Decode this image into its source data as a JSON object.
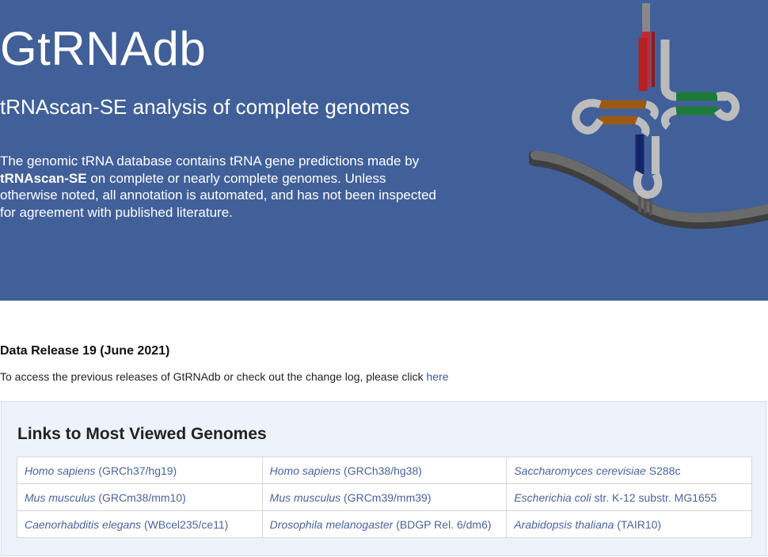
{
  "header": {
    "title": "GtRNAdb",
    "subtitle": "tRNAscan-SE analysis of complete genomes",
    "description_before": "The genomic tRNA database contains tRNA gene predictions made by ",
    "description_strong": "tRNAscan-SE",
    "description_after": " on complete or nearly complete genomes. Unless otherwise noted, all annotation is automated, and has not been inspected for agreement with published literature."
  },
  "release": {
    "title": "Data Release 19 (June 2021)",
    "text": "To access the previous releases of GtRNAdb or check out the change log, please click ",
    "link_label": "here"
  },
  "genomes": {
    "title": "Links to Most Viewed Genomes",
    "rows": [
      [
        {
          "species": "Homo sapiens",
          "build": " (GRCh37/hg19)"
        },
        {
          "species": "Homo sapiens",
          "build": " (GRCh38/hg38)"
        },
        {
          "species": "Saccharomyces cerevisiae",
          "build": " S288c"
        }
      ],
      [
        {
          "species": "Mus musculus",
          "build": " (GRCm38/mm10)"
        },
        {
          "species": "Mus musculus",
          "build": " (GRCm39/mm39)"
        },
        {
          "species": "Escherichia coli",
          "build": " str. K-12 substr. MG1655"
        }
      ],
      [
        {
          "species": "Caenorhabditis elegans",
          "build": " (WBcel235/ce11)"
        },
        {
          "species": "Drosophila melanogaster",
          "build": " (BDGP Rel. 6/dm6)"
        },
        {
          "species": "Arabidopsis thaliana",
          "build": " (TAIR10)"
        }
      ]
    ]
  },
  "colors": {
    "header_bg": "#41609a",
    "link": "#4a63a0",
    "panel_bg": "#edf3fb",
    "stem_red": "#b52025",
    "stem_green": "#1e7a3a",
    "stem_brown": "#9a5a14",
    "stem_navy": "#16246a",
    "strand_gray": "#5e5e5e"
  }
}
